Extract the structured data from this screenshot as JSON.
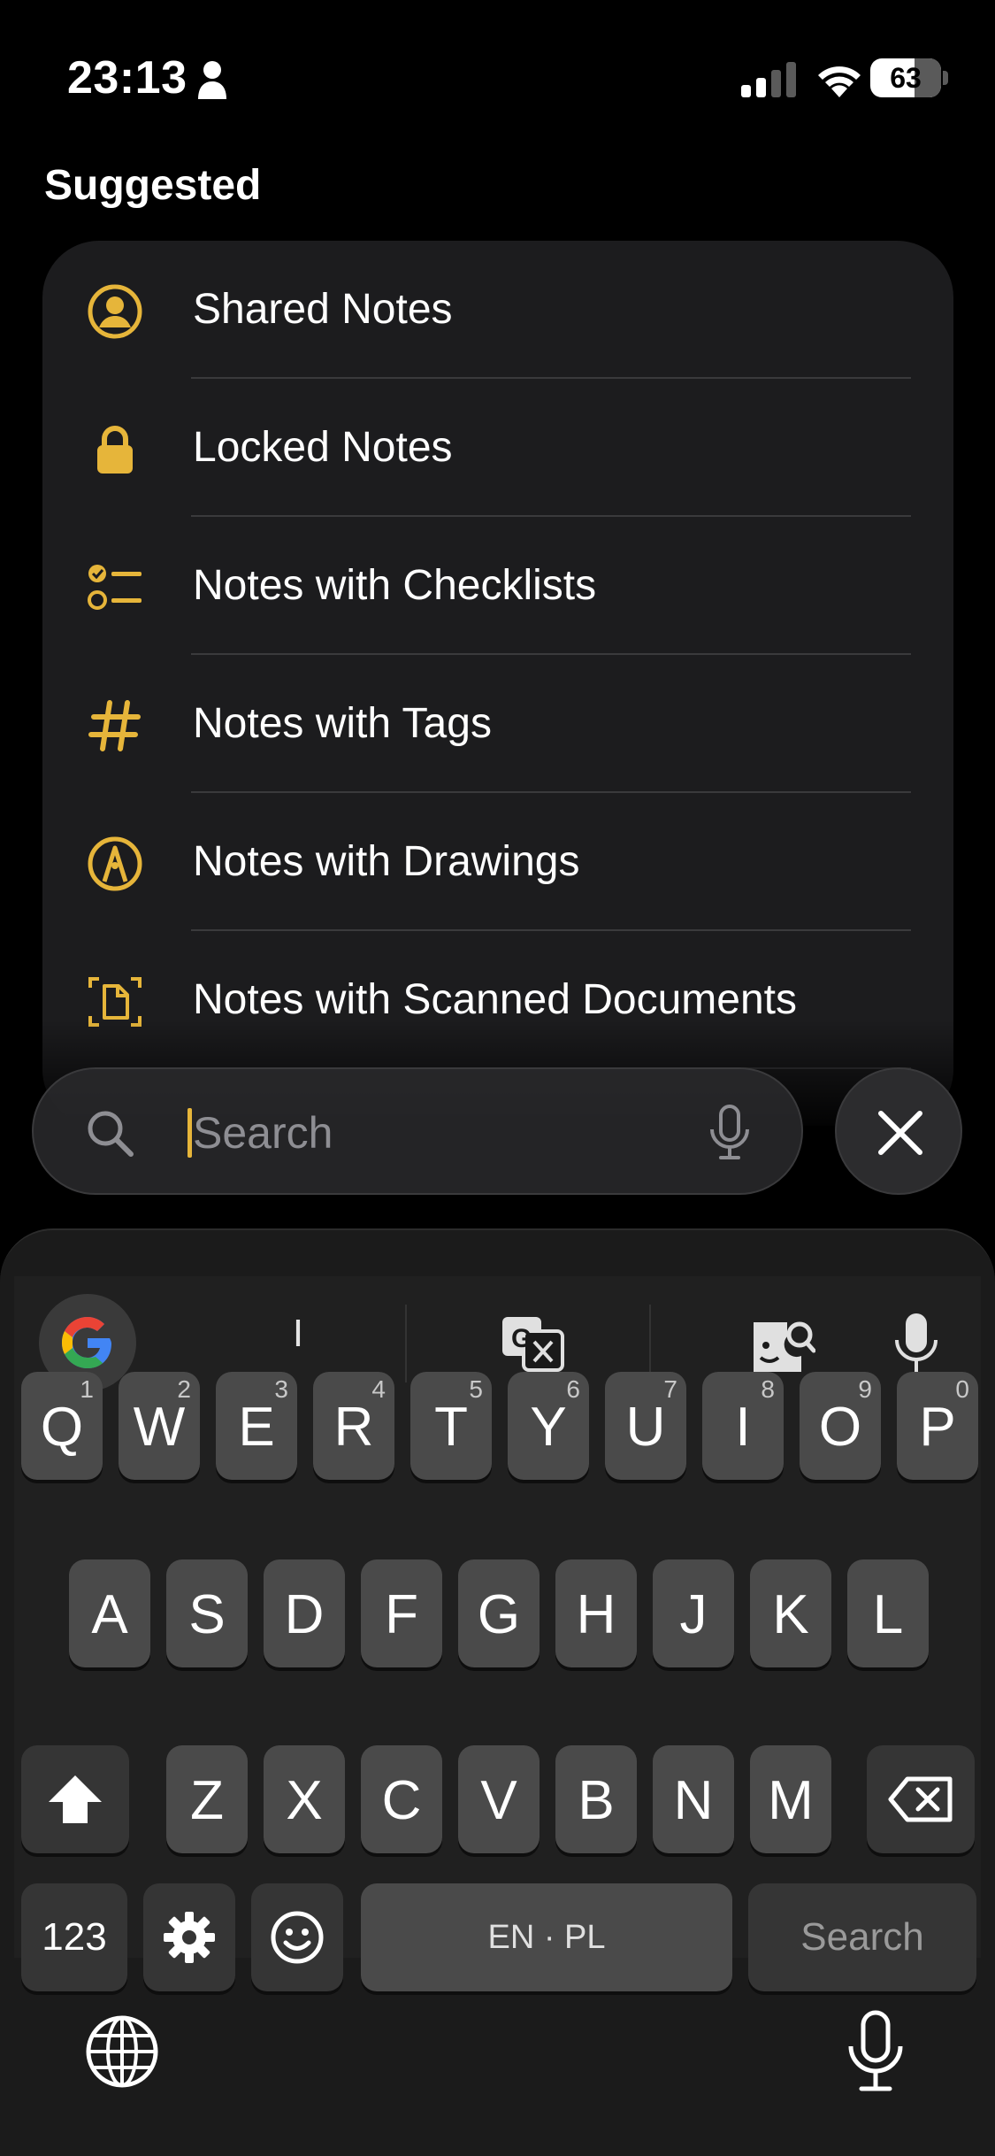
{
  "status_bar": {
    "time": "23:13",
    "battery_level": 63,
    "battery_text": "63"
  },
  "suggested": {
    "title": "Suggested",
    "items": [
      {
        "label": "Shared Notes",
        "icon": "person-circle-icon"
      },
      {
        "label": "Locked Notes",
        "icon": "lock-icon"
      },
      {
        "label": "Notes with Checklists",
        "icon": "checklist-icon"
      },
      {
        "label": "Notes with Tags",
        "icon": "hashtag-icon"
      },
      {
        "label": "Notes with Drawings",
        "icon": "pen-tip-circle-icon"
      },
      {
        "label": "Notes with Scanned Documents",
        "icon": "scan-document-icon"
      }
    ]
  },
  "search": {
    "placeholder": "Search"
  },
  "keyboard": {
    "suggestion": "I",
    "row1": [
      {
        "letter": "Q",
        "num": "1"
      },
      {
        "letter": "W",
        "num": "2"
      },
      {
        "letter": "E",
        "num": "3"
      },
      {
        "letter": "R",
        "num": "4"
      },
      {
        "letter": "T",
        "num": "5"
      },
      {
        "letter": "Y",
        "num": "6"
      },
      {
        "letter": "U",
        "num": "7"
      },
      {
        "letter": "I",
        "num": "8"
      },
      {
        "letter": "O",
        "num": "9"
      },
      {
        "letter": "P",
        "num": "0"
      }
    ],
    "row2": [
      "A",
      "S",
      "D",
      "F",
      "G",
      "H",
      "J",
      "K",
      "L"
    ],
    "row3": [
      "Z",
      "X",
      "C",
      "V",
      "B",
      "N",
      "M"
    ],
    "numbers_key": "123",
    "space_label": "EN · PL",
    "action_label": "Search"
  },
  "colors": {
    "accent": "#e6b53a",
    "card": "#1c1c1e",
    "key": "#4a4a4a",
    "key_dark": "#353535"
  }
}
